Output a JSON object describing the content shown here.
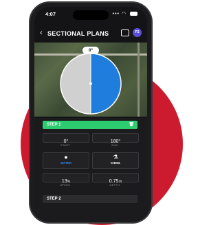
{
  "status": {
    "time": "4:07",
    "signal": "•••",
    "wifi": "◠"
  },
  "nav": {
    "back": "‹",
    "title": "SECTIONAL PLANS",
    "avatar": "FS"
  },
  "map": {
    "angle": "0°",
    "colors": {
      "covered": "#1f7ddd",
      "uncovered": "#d0d0d0"
    }
  },
  "step1": {
    "title": "STEP 1",
    "start": {
      "value": "0°",
      "label": "START"
    },
    "end": {
      "value": "180°",
      "label": "END"
    },
    "water": {
      "label": "WATER",
      "icon": "💧",
      "color": "#2f8cf0",
      "active": true
    },
    "chem": {
      "label": "CHEM.",
      "icon": "⚗",
      "color": "#ffffff",
      "active": false
    },
    "speed": {
      "value": "13",
      "unit": "%",
      "label": "SPEED"
    },
    "depth": {
      "value": "0.75",
      "unit": "in",
      "label": "DEPTH"
    }
  },
  "step2": {
    "title": "STEP 2"
  },
  "colors": {
    "accent_green": "#2ecc71",
    "brand_red": "#cc1b2f"
  }
}
